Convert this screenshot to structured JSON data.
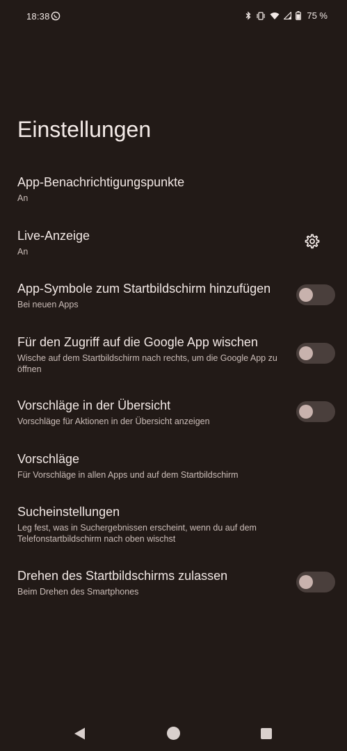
{
  "status_bar": {
    "time": "18:38",
    "left_icon": "whatsapp-icon",
    "right_icons": [
      "bluetooth-icon",
      "vibrate-icon",
      "wifi-icon",
      "signal-icon",
      "battery-icon"
    ],
    "battery": "75 %"
  },
  "page": {
    "title": "Einstellungen"
  },
  "settings": [
    {
      "title": "App-Benachrichtigungspunkte",
      "summary": "An"
    },
    {
      "title": "Live-Anzeige",
      "summary": "An",
      "icon": "gear-icon"
    },
    {
      "title": "App-Symbole zum Startbildschirm hinzufügen",
      "summary": "Bei neuen Apps",
      "toggle": "off"
    },
    {
      "title": "Für den Zugriff auf die Google App wischen",
      "summary": "Wische auf dem Startbildschirm nach rechts, um die Google App zu öffnen",
      "toggle": "off"
    },
    {
      "title": "Vorschläge in der Übersicht",
      "summary": "Vorschläge für Aktionen in der Übersicht anzeigen",
      "toggle": "off"
    },
    {
      "title": "Vorschläge",
      "summary": "Für Vorschläge in allen Apps und auf dem Startbildschirm"
    },
    {
      "title": "Sucheinstellungen",
      "summary": "Leg fest, was in Suchergebnissen erscheint, wenn du auf dem Telefonstartbildschirm nach oben wischst"
    },
    {
      "title": "Drehen des Startbildschirms zulassen",
      "summary": "Beim Drehen des Smartphones",
      "toggle": "off"
    }
  ],
  "nav_bar": {
    "buttons": [
      "back-icon",
      "home-icon",
      "recents-icon"
    ]
  },
  "colors": {
    "background": "#221a17",
    "text_primary": "#f2e8e5",
    "text_secondary": "#cbbdb8",
    "toggle_track": "#4a3f3c",
    "toggle_knob": "#c8b2ad"
  }
}
